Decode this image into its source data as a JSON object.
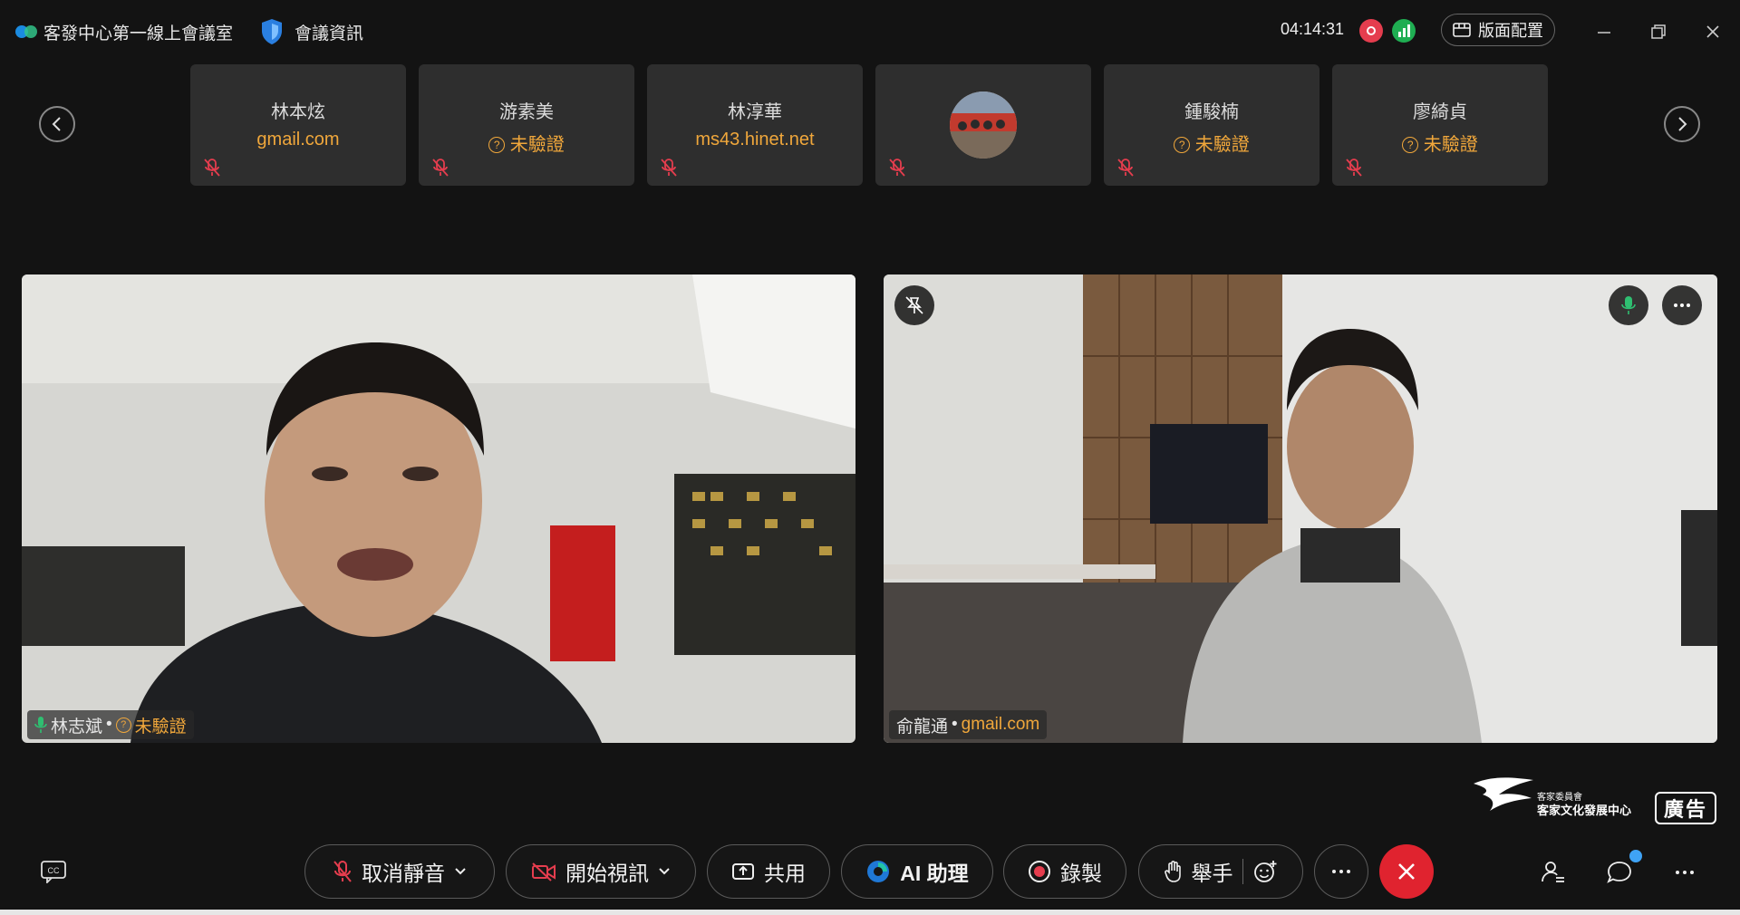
{
  "titlebar": {
    "room_title": "客發中心第一線上會議室",
    "meeting_info": "會議資訊",
    "timer": "04:14:31",
    "layout_button": "版面配置"
  },
  "participants": [
    {
      "name": "林本炫",
      "sub": "gmail.com",
      "sub_type": "domain",
      "muted": true
    },
    {
      "name": "游素美",
      "sub": "未驗證",
      "sub_type": "unverified",
      "muted": true
    },
    {
      "name": "林淳華",
      "sub": "ms43.hinet.net",
      "sub_type": "domain",
      "muted": true
    },
    {
      "name": "",
      "sub": "",
      "sub_type": "avatar",
      "muted": true
    },
    {
      "name": "鍾駿楠",
      "sub": "未驗證",
      "sub_type": "unverified",
      "muted": true
    },
    {
      "name": "廖綺貞",
      "sub": "未驗證",
      "sub_type": "unverified",
      "muted": true
    }
  ],
  "videos": [
    {
      "name": "林志斌",
      "separator": "•",
      "status": "未驗證"
    },
    {
      "name": "俞龍通",
      "separator": "•",
      "status": "gmail.com"
    }
  ],
  "ad": {
    "badge": "廣告",
    "org_line1": "客家委員會",
    "org_line2": "客家文化發展中心"
  },
  "toolbar": {
    "unmute": "取消靜音",
    "start_video": "開始視訊",
    "share": "共用",
    "ai_assistant": "AI 助理",
    "record": "錄製",
    "raise_hand": "舉手"
  },
  "colors": {
    "accent_orange": "#f0a73b",
    "end_red": "#e0232f",
    "record_red": "#e53d4e",
    "signal_green": "#1fae52"
  }
}
